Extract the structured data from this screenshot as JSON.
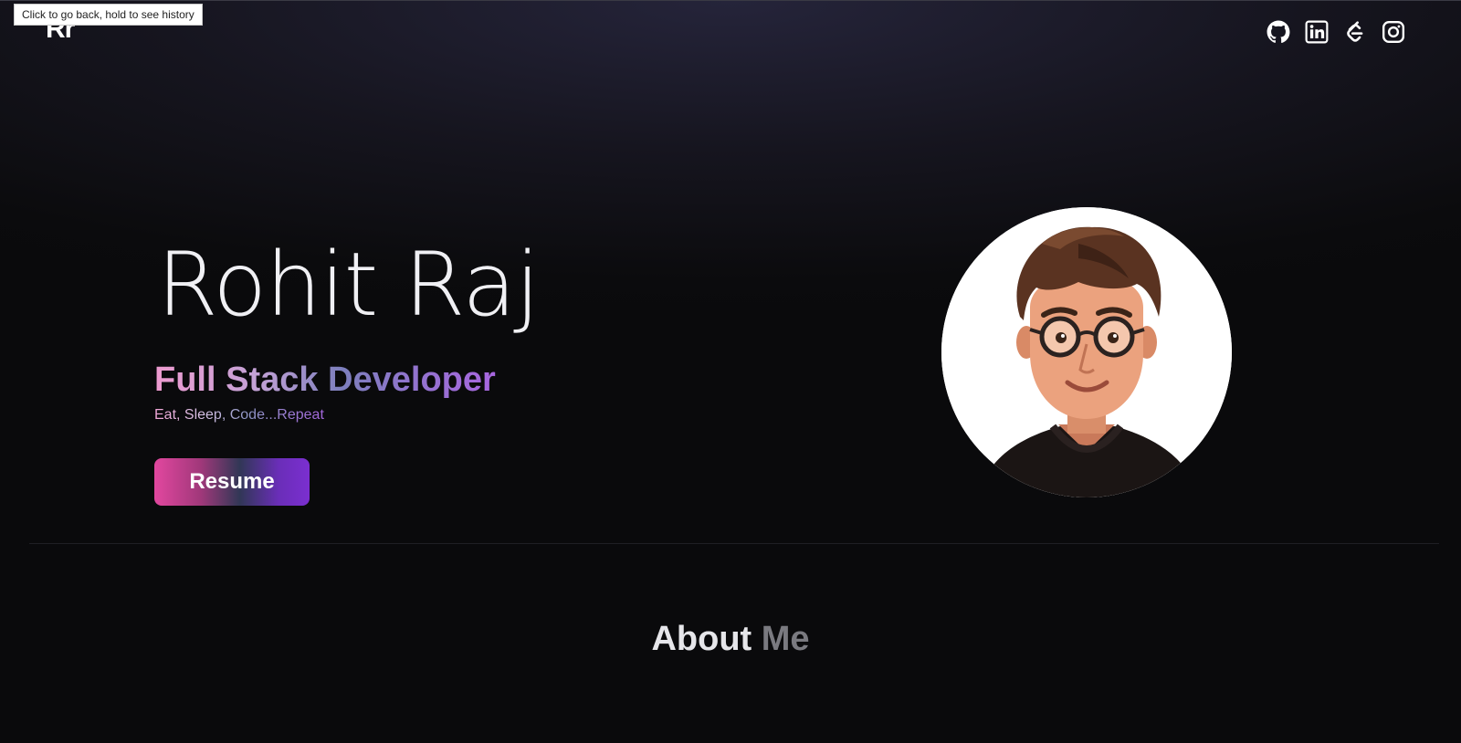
{
  "tooltip": {
    "text": "Click to go back, hold to see history"
  },
  "header": {
    "logo": "Rr",
    "socials": [
      {
        "icon": "github-icon",
        "label": "GitHub"
      },
      {
        "icon": "linkedin-icon",
        "label": "LinkedIn"
      },
      {
        "icon": "leetcode-icon",
        "label": "LeetCode"
      },
      {
        "icon": "instagram-icon",
        "label": "Instagram"
      }
    ]
  },
  "hero": {
    "name": "Rohit Raj",
    "role": "Full Stack Developer",
    "tagline": "Eat, Sleep, Code...Repeat",
    "resume_label": "Resume",
    "avatar": "developer-avatar-illustration"
  },
  "about": {
    "title_part1": "About",
    "title_part2": "Me"
  },
  "colors": {
    "background": "#0a0a0c",
    "gradient_pink": "#e2479f",
    "gradient_purple": "#7b2fd0"
  }
}
